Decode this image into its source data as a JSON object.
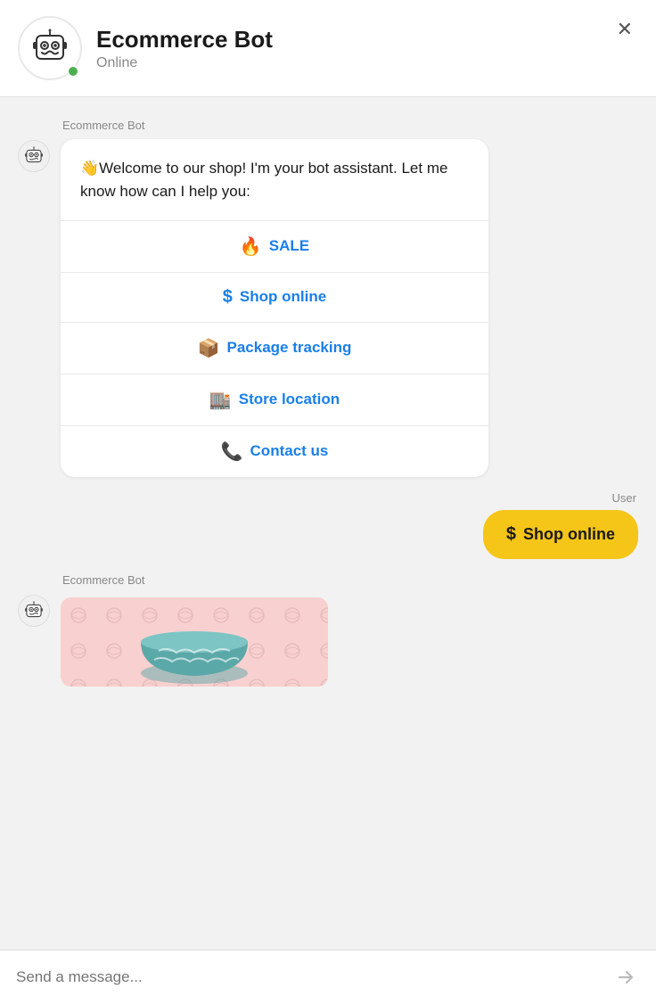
{
  "header": {
    "bot_name": "Ecommerce Bot",
    "status": "Online",
    "close_label": "×",
    "online_dot_color": "#4caf50"
  },
  "bot_sender_label": "Ecommerce Bot",
  "user_sender_label": "User",
  "welcome_message": "👋Welcome to our shop! I'm your bot assistant. Let me know how can I help you:",
  "menu_items": [
    {
      "icon": "🔥",
      "label": "SALE"
    },
    {
      "icon": "$",
      "label": "Shop online"
    },
    {
      "icon": "📦",
      "label": "Package tracking"
    },
    {
      "icon": "🏬",
      "label": "Store location"
    },
    {
      "icon": "📞",
      "label": "Contact us"
    }
  ],
  "user_message": {
    "icon": "$",
    "label": "Shop online"
  },
  "input_placeholder": "Send a message...",
  "accent_color": "#1a7fe8",
  "user_bubble_color": "#f5c518"
}
